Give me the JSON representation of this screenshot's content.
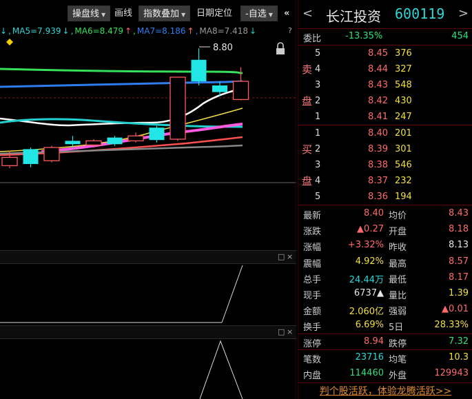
{
  "toolbar": {
    "operate_line": "操盘线",
    "draw_line": "画线",
    "index_overlay": "指数叠加",
    "date_locate": "日期定位",
    "watchlist": "-自选"
  },
  "ma_line": {
    "ma5": "MA5=7.939",
    "ma5_arrow": "↓",
    "ma6": "MA6=8.479",
    "ma6_arrow": "↑",
    "ma7": "MA7=8.186",
    "ma7_arrow": "↑",
    "ma8": "MA8=7.418",
    "ma8_arrow": "↓",
    "help": "?"
  },
  "chart": {
    "high_marker": "8.80",
    "colors": {
      "up": "#ff5a5a",
      "down": "#22e6e6",
      "ma_green": "#35e05a",
      "ma_blue": "#2f7ef0",
      "ma_white": "#ffffff",
      "ma_yellow": "#f0e040",
      "ma_magenta": "#ff5ae0",
      "ma_cyan": "#22d0d0",
      "ma_red": "#ff5050",
      "ma_gray": "#888888"
    }
  },
  "chart_data": {
    "type": "candlestick",
    "candles": [
      {
        "o": 7.48,
        "h": 7.56,
        "l": 7.35,
        "c": 7.38,
        "dir": "up"
      },
      {
        "o": 7.58,
        "h": 7.6,
        "l": 7.36,
        "c": 7.4,
        "dir": "down"
      },
      {
        "o": 7.44,
        "h": 7.62,
        "l": 7.42,
        "c": 7.6,
        "dir": "up"
      },
      {
        "o": 7.68,
        "h": 7.74,
        "l": 7.6,
        "c": 7.64,
        "dir": "down"
      },
      {
        "o": 7.63,
        "h": 7.7,
        "l": 7.6,
        "c": 7.68,
        "dir": "up"
      },
      {
        "o": 7.72,
        "h": 7.74,
        "l": 7.62,
        "c": 7.64,
        "dir": "down"
      },
      {
        "o": 7.68,
        "h": 7.78,
        "l": 7.66,
        "c": 7.74,
        "dir": "up"
      },
      {
        "o": 7.84,
        "h": 7.86,
        "l": 7.66,
        "c": 7.69,
        "dir": "down"
      },
      {
        "o": 7.7,
        "h": 8.45,
        "l": 7.68,
        "c": 8.45,
        "dir": "up"
      },
      {
        "o": 8.66,
        "h": 8.8,
        "l": 8.35,
        "c": 8.4,
        "dir": "down"
      },
      {
        "o": 8.35,
        "h": 8.4,
        "l": 8.22,
        "c": 8.27,
        "dir": "down"
      },
      {
        "o": 8.18,
        "h": 8.57,
        "l": 8.17,
        "c": 8.4,
        "dir": "up"
      }
    ]
  },
  "quote": {
    "prev_arrow": "<",
    "next_arrow": ">",
    "name": "长江投资",
    "code": "600119",
    "weibi_label": "委比",
    "weibi_pct": "-13.35%",
    "weibi_diff": "454",
    "sell_label_1": "卖",
    "sell_label_2": "盘",
    "buy_label_1": "买",
    "buy_label_2": "盘",
    "sell": [
      {
        "level": "5",
        "price": "8.45",
        "vol": "376"
      },
      {
        "level": "4",
        "price": "8.44",
        "vol": "327"
      },
      {
        "level": "3",
        "price": "8.43",
        "vol": "548"
      },
      {
        "level": "2",
        "price": "8.42",
        "vol": "430"
      },
      {
        "level": "1",
        "price": "8.41",
        "vol": "247"
      }
    ],
    "buy": [
      {
        "level": "1",
        "price": "8.40",
        "vol": "201"
      },
      {
        "level": "2",
        "price": "8.39",
        "vol": "301"
      },
      {
        "level": "3",
        "price": "8.38",
        "vol": "546"
      },
      {
        "level": "4",
        "price": "8.37",
        "vol": "232"
      },
      {
        "level": "5",
        "price": "8.36",
        "vol": "194"
      }
    ],
    "stats": [
      {
        "l1": "最新",
        "v1": "8.40",
        "c1": "red",
        "l2": "均价",
        "v2": "8.43",
        "c2": "red"
      },
      {
        "l1": "涨跌",
        "v1": "▲0.27",
        "c1": "red",
        "l2": "开盘",
        "v2": "8.18",
        "c2": "red"
      },
      {
        "l1": "涨幅",
        "v1": "+3.32%",
        "c1": "red",
        "l2": "昨收",
        "v2": "8.13",
        "c2": "white"
      },
      {
        "l1": "震幅",
        "v1": "4.92%",
        "c1": "yellow",
        "l2": "最高",
        "v2": "8.57",
        "c2": "red"
      },
      {
        "l1": "总手",
        "v1": "24.44万",
        "c1": "cyan",
        "l2": "最低",
        "v2": "8.17",
        "c2": "red"
      },
      {
        "l1": "现手",
        "v1": "6737▲",
        "c1": "white",
        "l2": "量比",
        "v2": "1.39",
        "c2": "yellow"
      },
      {
        "l1": "金额",
        "v1": "2.060亿",
        "c1": "yellow",
        "l2": "强弱",
        "v2": "▲0.01",
        "c2": "red"
      },
      {
        "l1": "换手",
        "v1": "6.69%",
        "c1": "yellow",
        "l2": "5日",
        "v2": "28.33%",
        "c2": "yellow"
      },
      {
        "l1": "涨停",
        "v1": "8.94",
        "c1": "red",
        "l2": "跌停",
        "v2": "7.32",
        "c2": "green"
      },
      {
        "l1": "笔数",
        "v1": "23716",
        "c1": "cyan",
        "l2": "均笔",
        "v2": "10.3",
        "c2": "yellow"
      },
      {
        "l1": "内盘",
        "v1": "114460",
        "c1": "green",
        "l2": "外盘",
        "v2": "129943",
        "c2": "red"
      }
    ],
    "promo": "判个股活跃，体验龙腾活跃>>"
  },
  "panels": {
    "restore": "□",
    "close": "×"
  }
}
